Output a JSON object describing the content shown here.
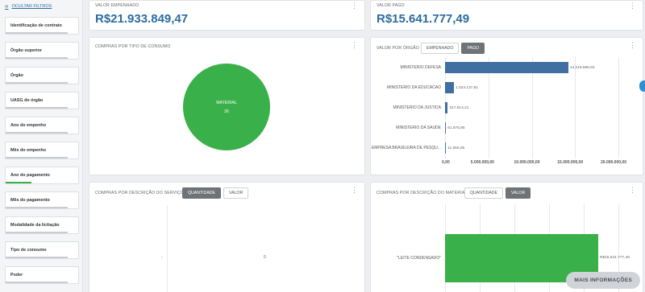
{
  "sidebar": {
    "hide_filters": "OCULTAR FILTROS",
    "filters": [
      {
        "label": "Identificação de contrato",
        "bar": 0.85,
        "active": false
      },
      {
        "label": "Órgão superior",
        "bar": 0.85,
        "active": false
      },
      {
        "label": "Órgão",
        "bar": 0.85,
        "active": false
      },
      {
        "label": "UASG do órgão",
        "bar": 0.85,
        "active": false
      },
      {
        "label": "Ano do empenho",
        "bar": 0.85,
        "active": false
      },
      {
        "label": "Mês do empenho",
        "bar": 0.85,
        "active": false
      },
      {
        "label": "Ano do pagamento",
        "bar": 0.35,
        "active": true
      },
      {
        "label": "Mês do pagamento",
        "bar": 0.85,
        "active": false
      },
      {
        "label": "Modalidade da licitação",
        "bar": 0.85,
        "active": false
      },
      {
        "label": "Tipo de consumo",
        "bar": 0.85,
        "active": false
      },
      {
        "label": "Poder",
        "bar": 0.85,
        "active": false
      }
    ]
  },
  "kpis": {
    "empenhado_title": "VALOR EMPENHADO",
    "empenhado_value": "R$21.933.849,47",
    "pago_title": "VALOR PAGO",
    "pago_value": "R$15.641.777,49"
  },
  "pie_card": {
    "title": "COMPRAS POR TIPO DE CONSUMO",
    "slice_label": "MATERIAL",
    "slice_value": "26",
    "color": "#3ab04a"
  },
  "orgao_card": {
    "title": "VALOR POR ÓRGÃO",
    "toggles": [
      "EMPENHADO",
      "PAGO"
    ],
    "active_toggle": 1,
    "bar_color": "#3f6fa3"
  },
  "servico_card": {
    "title": "COMPRAS POR DESCRIÇÃO DO SERVIÇO",
    "toggles": [
      "QUANTIDADE",
      "VALOR"
    ],
    "active_toggle": 0,
    "left_label": "-",
    "right_label": "0"
  },
  "material_card": {
    "title": "COMPRAS POR DESCRIÇÃO DO MATERIAL",
    "toggles": [
      "QUANTIDADE",
      "VALOR"
    ],
    "active_toggle": 1,
    "bar_color": "#3ab04a"
  },
  "more_button": "MAIS INFORMAÇÕES",
  "chart_data": [
    {
      "type": "pie",
      "title": "COMPRAS POR TIPO DE CONSUMO",
      "categories": [
        "MATERIAL"
      ],
      "values": [
        26
      ]
    },
    {
      "type": "bar",
      "orientation": "horizontal",
      "title": "VALOR POR ÓRGÃO",
      "categories": [
        "MINISTERIO DEFESA",
        "MINISTERIO DA EDUCACAO",
        "MINISTERIO DA JUSTICA",
        "MINISTERIO DA SAUDE",
        "EMPRESA BRASILEIRA DE PESQU..."
      ],
      "values": [
        14218666.93,
        1023137.81,
        317614.21,
        61875.85,
        11655.06
      ],
      "value_labels": [
        "14.218.666,93",
        "1.023.137,81",
        "317.614,21",
        "61.875,85",
        "11.655,06"
      ],
      "xlim": [
        0,
        20000000
      ],
      "xticks": [
        "0,00",
        "5.000.000,00",
        "10.000.000,00",
        "15.000.000,00",
        "20.000.000,00"
      ]
    },
    {
      "type": "bar",
      "orientation": "horizontal",
      "title": "COMPRAS POR DESCRIÇÃO DO MATERIAL",
      "categories": [
        "\"LEITE CONDENSADO\""
      ],
      "values": [
        15641777.49
      ],
      "value_labels": [
        "R$15.641.777,49"
      ]
    }
  ]
}
